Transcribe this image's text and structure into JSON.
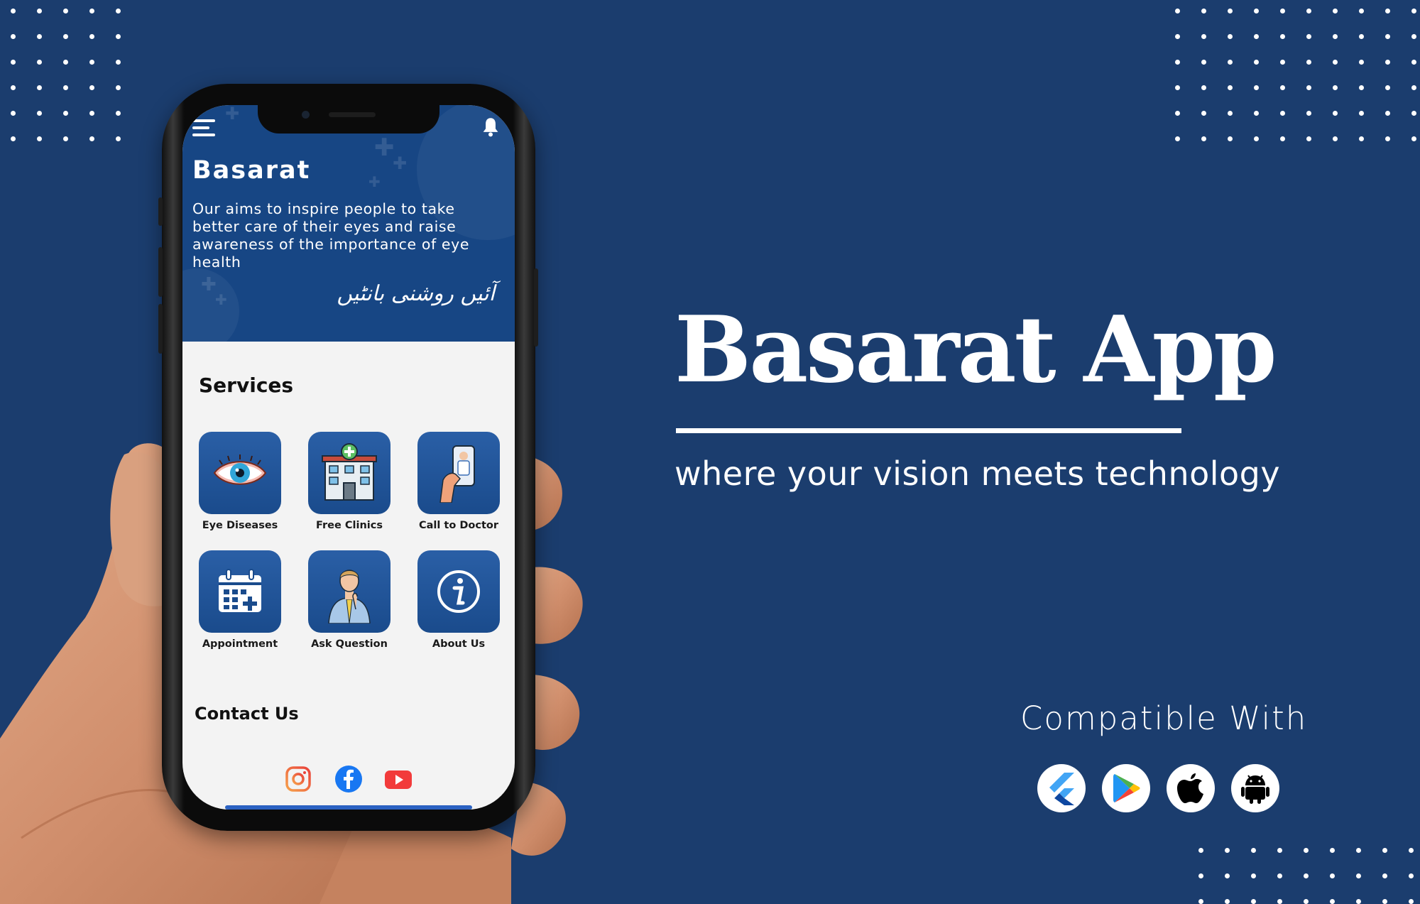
{
  "app": {
    "title": "Basarat",
    "description": "Our aims to inspire people to take better care of their eyes and raise awareness of the importance of eye health",
    "urdu_tagline": "آئیں روشنی بانٹیں"
  },
  "services": {
    "heading": "Services",
    "items": [
      {
        "label": "Eye Diseases",
        "icon": "eye-icon"
      },
      {
        "label": "Free Clinics",
        "icon": "hospital-icon"
      },
      {
        "label": "Call to Doctor",
        "icon": "phone-doctor-icon"
      },
      {
        "label": "Appointment",
        "icon": "calendar-icon"
      },
      {
        "label": "Ask Question",
        "icon": "thinking-person-icon"
      },
      {
        "label": "About Us",
        "icon": "info-icon"
      }
    ]
  },
  "contact": {
    "heading": "Contact Us",
    "socials": [
      "instagram-icon",
      "facebook-icon",
      "youtube-icon"
    ]
  },
  "hero": {
    "title": "Basarat App",
    "tagline": "where your vision meets technology",
    "compatible_label": "Compatible With",
    "platforms": [
      "flutter-icon",
      "google-play-icon",
      "apple-icon",
      "android-icon"
    ]
  },
  "colors": {
    "background": "#1b3d6e",
    "app_header": "#174684",
    "tile": "#1a4b8c",
    "screen_bg": "#f3f3f3"
  }
}
